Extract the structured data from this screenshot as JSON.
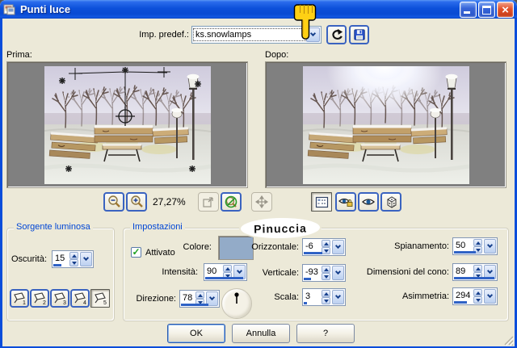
{
  "window": {
    "title": "Punti luce"
  },
  "preset": {
    "label": "Imp. predef.:",
    "value": "ks.snowlamps"
  },
  "preview": {
    "before_label": "Prima:",
    "after_label": "Dopo:",
    "zoom_percent": "27,27%"
  },
  "groups": {
    "light_source": {
      "title": "Sorgente luminosa",
      "darkness": {
        "label": "Oscurità:",
        "value": "15"
      },
      "source_buttons": [
        "1",
        "2",
        "3",
        "4",
        "5"
      ],
      "selected_source": "5"
    },
    "settings": {
      "title": "Impostazioni",
      "enabled": {
        "label": "Attivato",
        "checked": true,
        "check_glyph": "✓"
      },
      "color": {
        "label": "Colore:",
        "swatch_hex": "#93abc8"
      },
      "intensity": {
        "label": "Intensità:",
        "value": "90"
      },
      "direction": {
        "label": "Direzione:",
        "value": "78"
      },
      "horizontal": {
        "label": "Orizzontale:",
        "value": "-6"
      },
      "vertical": {
        "label": "Verticale:",
        "value": "-93"
      },
      "scale": {
        "label": "Scala:",
        "value": "3"
      },
      "smoothing": {
        "label": "Spianamento:",
        "value": "50"
      },
      "cone_size": {
        "label": "Dimensioni del cono:",
        "value": "89"
      },
      "asymmetry": {
        "label": "Asimmetria:",
        "value": "294"
      }
    }
  },
  "watermark": {
    "text": "Pinuccia"
  },
  "footer": {
    "ok": "OK",
    "cancel": "Annulla",
    "help": "?"
  },
  "colors": {
    "titlebar": "#0c50da",
    "progress": "#2f62c5",
    "group_title": "#0046d5",
    "swatch": "#93abc8"
  }
}
